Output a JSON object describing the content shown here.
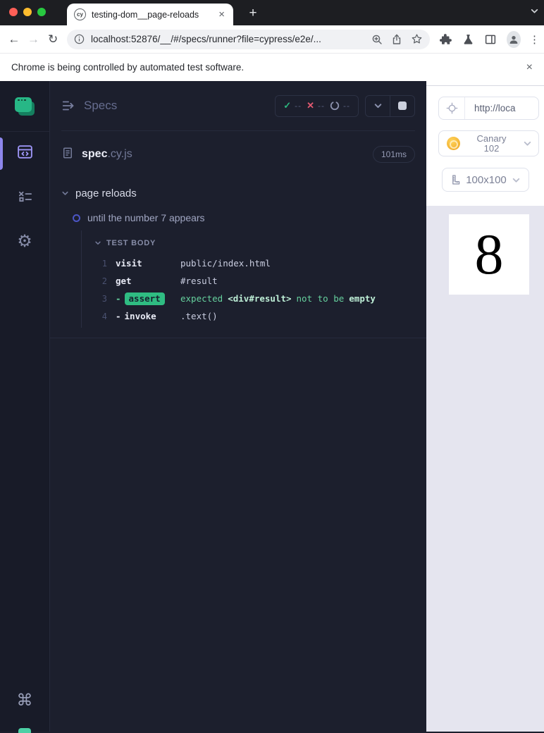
{
  "colors": {
    "accent_lavender": "#9d95f5",
    "jade_green": "#2fbc82",
    "fail_red": "#e25a71",
    "canary_orange": "#eda21f",
    "reporter_bg": "#1c1f2d",
    "sidebar_bg": "#181b28",
    "aut_bg": "#e5e5ef"
  },
  "icons": {
    "close": "×",
    "plus": "+",
    "kebab": "⋮",
    "back": "←",
    "forward": "→",
    "reload": "↻",
    "check": "✓",
    "cross": "✕",
    "gear": "⚙",
    "command": "⌘"
  },
  "browser": {
    "tab_title": "testing-dom__page-reloads",
    "favicon_text": "cy",
    "url": "localhost:52876/__/#/specs/runner?file=cypress/e2e/...",
    "infobar_message": "Chrome is being controlled by automated test software."
  },
  "reporter": {
    "title": "Specs",
    "stats": {
      "passed": "--",
      "failed": "--",
      "pending": "--"
    },
    "spec_name": "spec",
    "spec_ext": ".cy.js",
    "spec_duration": "101ms",
    "suite_title": "page reloads",
    "test_title": "until the number 7 appears",
    "section_title": "TEST BODY",
    "commands": [
      {
        "num": "1",
        "name": "visit",
        "message": "public/index.html"
      },
      {
        "num": "2",
        "name": "get",
        "message": "#result"
      },
      {
        "num": "3",
        "dash": "-",
        "badge": "assert",
        "parts": [
          "expected",
          "<div#result>",
          "not to be",
          "empty"
        ]
      },
      {
        "num": "4",
        "dash": "-",
        "name": "invoke",
        "message": ".text()"
      }
    ]
  },
  "aut": {
    "url_display": "http://loca",
    "browser_line1": "Canary",
    "browser_line2": "102",
    "viewport": "100x100",
    "result_number": "8"
  }
}
